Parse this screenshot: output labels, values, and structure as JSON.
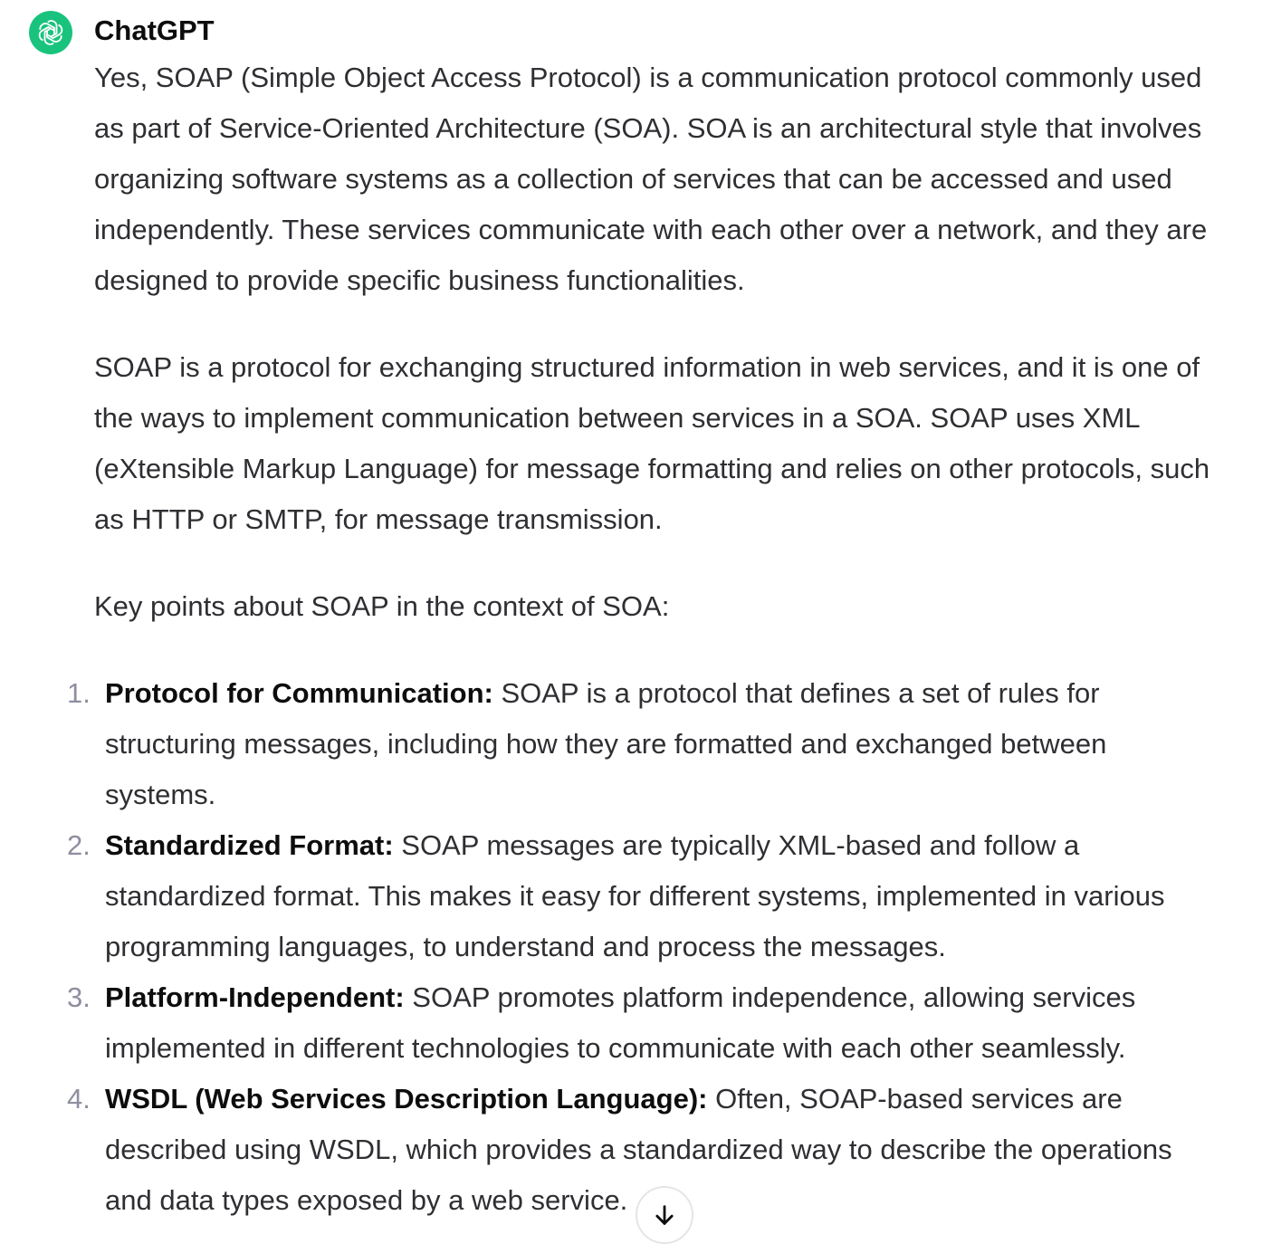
{
  "message": {
    "author": "ChatGPT",
    "avatar_icon": "openai-logo-icon",
    "avatar_color": "#19c37d",
    "paragraphs": [
      "Yes, SOAP (Simple Object Access Protocol) is a communication protocol commonly used as part of Service-Oriented Architecture (SOA). SOA is an architectural style that involves organizing software systems as a collection of services that can be accessed and used independently. These services communicate with each other over a network, and they are designed to provide specific business functionalities.",
      "SOAP is a protocol for exchanging structured information in web services, and it is one of the ways to implement communication between services in a SOA. SOAP uses XML (eXtensible Markup Language) for message formatting and relies on other protocols, such as HTTP or SMTP, for message transmission.",
      "Key points about SOAP in the context of SOA:"
    ],
    "list": [
      {
        "number": "1.",
        "title": "Protocol for Communication:",
        "text": " SOAP is a protocol that defines a set of rules for structuring messages, including how they are formatted and exchanged between systems."
      },
      {
        "number": "2.",
        "title": "Standardized Format:",
        "text": " SOAP messages are typically XML-based and follow a standardized format. This makes it easy for different systems, implemented in various programming languages, to understand and process the messages."
      },
      {
        "number": "3.",
        "title": "Platform-Independent:",
        "text": " SOAP promotes platform independence, allowing services implemented in different technologies to communicate with each other seamlessly."
      },
      {
        "number": "4.",
        "title": "WSDL (Web Services Description Language):",
        "text": " Often, SOAP-based services are described using WSDL, which provides a standardized way to describe the operations and data types exposed by a web service."
      }
    ]
  },
  "scroll_button": {
    "icon": "arrow-down-icon"
  }
}
